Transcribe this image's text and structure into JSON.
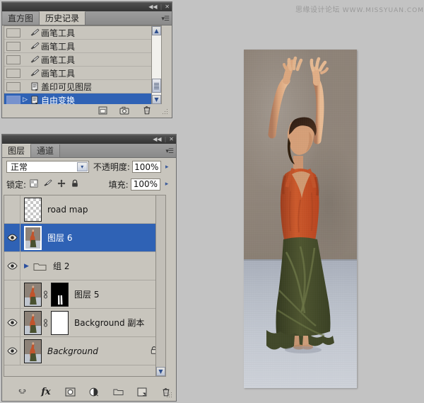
{
  "watermark": {
    "cn": "思缘设计论坛",
    "en": "WWW.MISSYUAN.COM"
  },
  "history_panel": {
    "title_buttons": {
      "collapse": "◀◀",
      "separator": "|",
      "close": "✕"
    },
    "menu_icon": "panel-menu-icon",
    "tabs": [
      {
        "label": "直方图",
        "active": false
      },
      {
        "label": "历史记录",
        "active": true
      }
    ],
    "items": [
      {
        "label": "画笔工具",
        "icon": "brush-tool-icon",
        "selected": false,
        "has_arrow": false
      },
      {
        "label": "画笔工具",
        "icon": "brush-tool-icon",
        "selected": false,
        "has_arrow": false
      },
      {
        "label": "画笔工具",
        "icon": "brush-tool-icon",
        "selected": false,
        "has_arrow": false
      },
      {
        "label": "画笔工具",
        "icon": "brush-tool-icon",
        "selected": false,
        "has_arrow": false
      },
      {
        "label": "盖印可见图层",
        "icon": "document-state-icon",
        "selected": false,
        "has_arrow": false
      },
      {
        "label": "自由变换",
        "icon": "document-state-icon",
        "selected": true,
        "has_arrow": true
      }
    ],
    "footer_buttons": [
      {
        "name": "new-document-from-state-button",
        "icon": "new-document-icon"
      },
      {
        "name": "new-snapshot-button",
        "icon": "camera-icon"
      },
      {
        "name": "delete-state-button",
        "icon": "trash-icon"
      }
    ],
    "scrollbar": {
      "up": "▲",
      "down": "▼"
    }
  },
  "layers_panel": {
    "title_buttons": {
      "collapse": "◀◀",
      "separator": "|",
      "close": "✕"
    },
    "menu_icon": "panel-menu-icon",
    "tabs": [
      {
        "label": "图层",
        "active": true
      },
      {
        "label": "通道",
        "active": false
      }
    ],
    "blend_mode": {
      "label": "",
      "value": "正常",
      "caret": "▾"
    },
    "opacity": {
      "label": "不透明度:",
      "value": "100%",
      "stepper": "▸"
    },
    "fill": {
      "label": "填充:",
      "value": "100%",
      "stepper": "▸"
    },
    "lock": {
      "label": "锁定:",
      "icons": [
        {
          "name": "lock-transparent-pixels-icon"
        },
        {
          "name": "lock-image-pixels-icon"
        },
        {
          "name": "lock-position-icon"
        },
        {
          "name": "lock-all-icon"
        }
      ]
    },
    "layers": [
      {
        "name": "road map",
        "visible": false,
        "selected": false,
        "thumb": "transparent",
        "italic": false,
        "locked": false,
        "kind": "layer"
      },
      {
        "name": "图层 6",
        "visible": true,
        "selected": true,
        "thumb": "photo",
        "italic": false,
        "locked": false,
        "kind": "layer"
      },
      {
        "name": "组 2",
        "visible": true,
        "selected": false,
        "thumb": "folder",
        "italic": false,
        "locked": false,
        "kind": "group",
        "expand_arrow": "▶"
      },
      {
        "name": "图层 5",
        "visible": false,
        "selected": false,
        "thumb": "photo",
        "mask": "black-mask-with-legs",
        "italic": false,
        "locked": false,
        "kind": "layer"
      },
      {
        "name": "Background 副本",
        "visible": true,
        "selected": false,
        "thumb": "photo",
        "mask": "white-mask",
        "italic": false,
        "locked": false,
        "kind": "layer"
      },
      {
        "name": "Background",
        "visible": true,
        "selected": false,
        "thumb": "photo",
        "italic": true,
        "locked": true,
        "kind": "layer"
      }
    ],
    "footer_buttons": [
      {
        "name": "link-layers-button",
        "icon": "link-icon"
      },
      {
        "name": "layer-style-button",
        "icon": "fx-icon",
        "label": "fx"
      },
      {
        "name": "add-layer-mask-button",
        "icon": "mask-icon"
      },
      {
        "name": "adjustment-layer-button",
        "icon": "half-circle-icon"
      },
      {
        "name": "new-group-button",
        "icon": "folder-icon"
      },
      {
        "name": "new-layer-button",
        "icon": "new-layer-icon"
      },
      {
        "name": "delete-layer-button",
        "icon": "trash-icon"
      }
    ],
    "scrollbar": {
      "down": "▼"
    }
  },
  "canvas": {
    "image_alt": "dancer-photo",
    "subject": "woman with arms raised, orange tank top, olive green ruffled skirt, concrete wall background"
  }
}
